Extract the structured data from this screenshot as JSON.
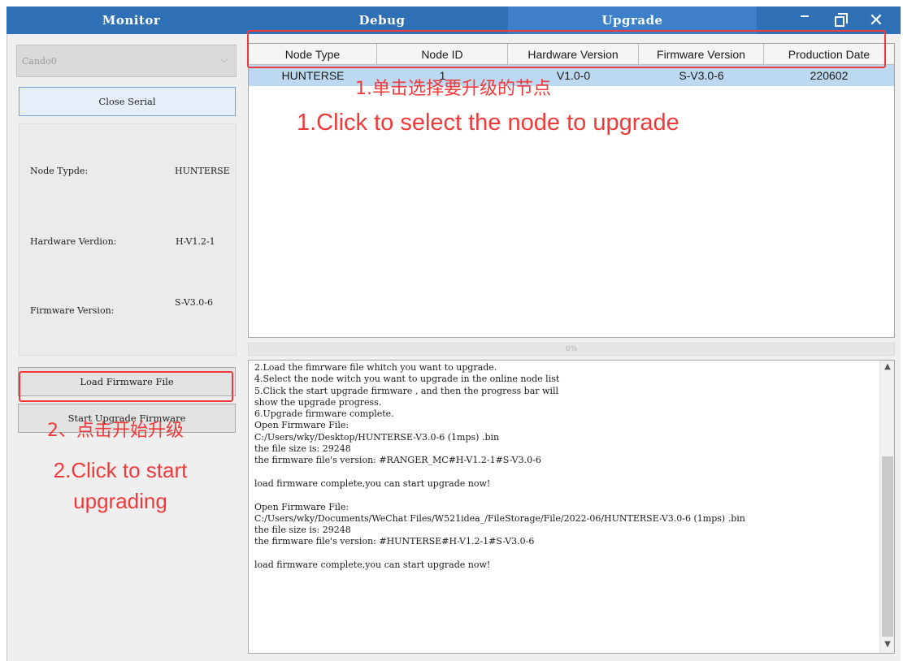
{
  "tabs": [
    {
      "label": "Monitor"
    },
    {
      "label": "Debug"
    },
    {
      "label": "Upgrade"
    }
  ],
  "active_tab": "Upgrade",
  "window_controls": {
    "close_glyph": "✕"
  },
  "sidebar": {
    "port_select": {
      "value": "Cando0"
    },
    "close_serial_label": "Close Serial",
    "info": [
      {
        "label": "Node Typde:",
        "value": "HUNTERSE"
      },
      {
        "label": "Hardware Verdion:",
        "value": "H-V1.2-1"
      },
      {
        "label": "Firmware Version:",
        "value": "S-V3.0-6"
      }
    ],
    "load_firmware_label": "Load Firmware File",
    "start_upgrade_label": "Start Upgrade Firmware"
  },
  "node_table": {
    "columns": [
      "Node Type",
      "Node ID",
      "Hardware Version",
      "Firmware Version",
      "Production Date"
    ],
    "rows": [
      [
        "HUNTERSE",
        "1",
        "V1.0-0",
        "S-V3.0-6",
        "220602"
      ]
    ]
  },
  "progress": {
    "value": 0,
    "text": "0%"
  },
  "log": [
    "2.Load the fimrware file whitch you want to upgrade.",
    "4.Select the node witch you want to upgrade in the online node list",
    "5.Click the start upgrade firmware , and then the progress bar will",
    "show the upgrade progress.",
    "6.Upgrade firmware complete.",
    "Open Firmware File:",
    "C:/Users/wky/Desktop/HUNTERSE-V3.0-6 (1mps) .bin",
    "the file size is: 29248",
    "the firmware file's version: #RANGER_MC#H-V1.2-1#S-V3.0-6",
    "",
    "load firmware complete,you can start upgrade now!",
    "",
    "Open Firmware File:",
    "C:/Users/wky/Documents/WeChat Files/W521idea_/FileStorage/File/2022-06/HUNTERSE-V3.0-6 (1mps) .bin",
    "the file size is: 29248",
    "the firmware file's version: #HUNTERSE#H-V1.2-1#S-V3.0-6",
    "",
    "load firmware complete,you can start upgrade now!"
  ],
  "annotations": {
    "step1_cn": "1.单击选择要升级的节点",
    "step1_en": "1.Click to select the node to upgrade",
    "step2_cn": "2、点击开始升级",
    "step2_en": "2.Click to start upgrading"
  },
  "colors": {
    "title_bar": "#2e6fb5",
    "active_tab": "#3d80c9",
    "selected_row": "#bcd9f1",
    "annotation_red": "#f03a3a"
  }
}
